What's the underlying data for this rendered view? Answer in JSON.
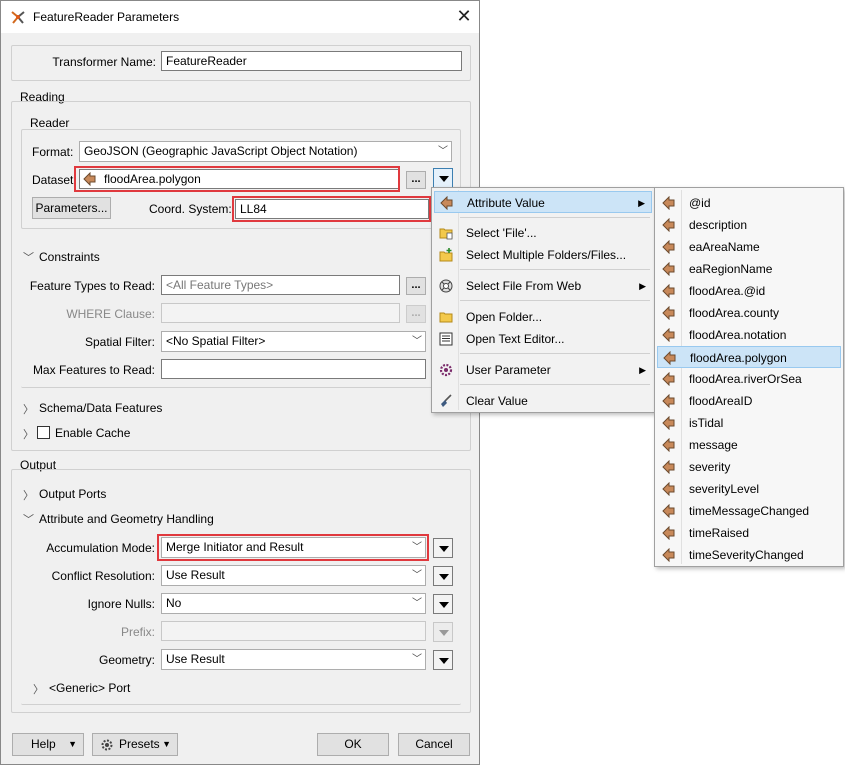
{
  "dialog": {
    "title": "FeatureReader Parameters",
    "transformer_name_label": "Transformer Name:",
    "transformer_name_value": "FeatureReader",
    "reading": {
      "section_label": "Reading",
      "reader_label": "Reader",
      "format_label": "Format:",
      "format_value": "GeoJSON (Geographic JavaScript Object Notation)",
      "dataset_label": "Dataset:",
      "dataset_value": "floodArea.polygon",
      "parameters_button": "Parameters...",
      "coord_system_label": "Coord. System:",
      "coord_system_value": "LL84",
      "constraints_label": "Constraints",
      "feature_types_label": "Feature Types to Read:",
      "feature_types_placeholder": "<All Feature Types>",
      "where_clause_label": "WHERE Clause:",
      "spatial_filter_label": "Spatial Filter:",
      "spatial_filter_value": "<No Spatial Filter>",
      "max_features_label": "Max Features to Read:",
      "schema_label": "Schema/Data Features",
      "cache_label": "Enable Cache"
    },
    "output": {
      "section_label": "Output",
      "ports_label": "Output Ports",
      "attr_geom_label": "Attribute and Geometry Handling",
      "accumulation_label": "Accumulation Mode:",
      "accumulation_value": "Merge Initiator and Result",
      "conflict_label": "Conflict Resolution:",
      "conflict_value": "Use Result",
      "ignore_nulls_label": "Ignore Nulls:",
      "ignore_nulls_value": "No",
      "prefix_label": "Prefix:",
      "geometry_label": "Geometry:",
      "geometry_value": "Use Result",
      "generic_port_label": "<Generic> Port"
    },
    "footer": {
      "help": "Help",
      "presets": "Presets",
      "ok": "OK",
      "cancel": "Cancel"
    },
    "ellipsis": "..."
  },
  "context_menu": {
    "items": [
      {
        "label": "Attribute Value",
        "icon": "attribute-arrow-icon",
        "submenu": true
      },
      {
        "label": "Select 'File'...",
        "icon": "folder-file-icon"
      },
      {
        "label": "Select Multiple Folders/Files...",
        "icon": "folder-plus-icon"
      },
      {
        "label": "Select File From Web",
        "icon": "web-icon",
        "submenu": true
      },
      {
        "label": "Open Folder...",
        "icon": "folder-icon"
      },
      {
        "label": "Open Text Editor...",
        "icon": "text-editor-icon"
      },
      {
        "label": "User Parameter",
        "icon": "gear-icon",
        "submenu": true
      },
      {
        "label": "Clear Value",
        "icon": "broom-icon"
      }
    ]
  },
  "attribute_menu": {
    "items": [
      "@id",
      "description",
      "eaAreaName",
      "eaRegionName",
      "floodArea.@id",
      "floodArea.county",
      "floodArea.notation",
      "floodArea.polygon",
      "floodArea.riverOrSea",
      "floodAreaID",
      "isTidal",
      "message",
      "severity",
      "severityLevel",
      "timeMessageChanged",
      "timeRaised",
      "timeSeverityChanged"
    ],
    "selected": "floodArea.polygon"
  },
  "colors": {
    "highlight": "#cce4f7",
    "red_box": "#e0393e",
    "attr_icon": "#c8895a"
  }
}
